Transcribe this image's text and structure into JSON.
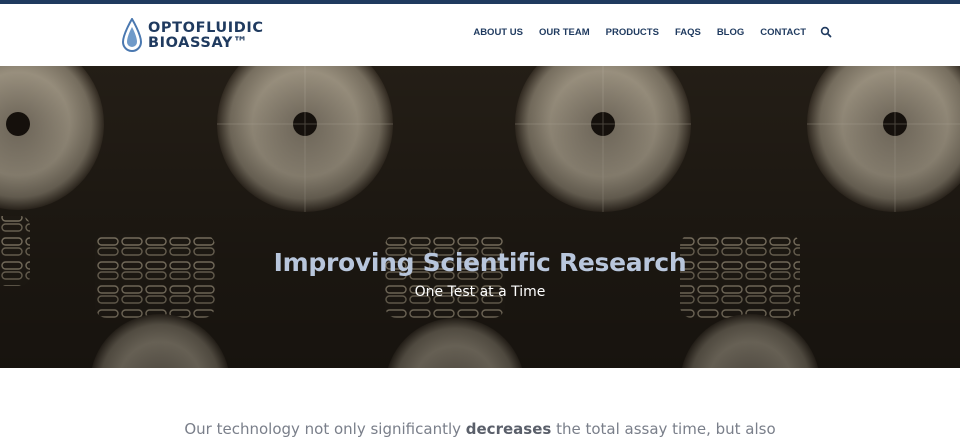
{
  "brand": {
    "line1": "OPTOFLUIDIC",
    "line2": "BIOASSAY™",
    "icon": "droplet-icon"
  },
  "nav": {
    "items": [
      {
        "label": "ABOUT US"
      },
      {
        "label": "OUR TEAM"
      },
      {
        "label": "PRODUCTS"
      },
      {
        "label": "FAQS"
      },
      {
        "label": "BLOG"
      },
      {
        "label": "CONTACT"
      }
    ],
    "search_icon": "search-icon"
  },
  "hero": {
    "title": "Improving Scientific Research",
    "subtitle": "One Test at a Time"
  },
  "intro": {
    "before": "Our technology not only significantly ",
    "emphasis": "decreases",
    "after": " the total assay time, but also"
  },
  "colors": {
    "brand": "#1f3a5f",
    "hero_title": "#b8c6dc",
    "body_text": "#7a7f8a"
  }
}
